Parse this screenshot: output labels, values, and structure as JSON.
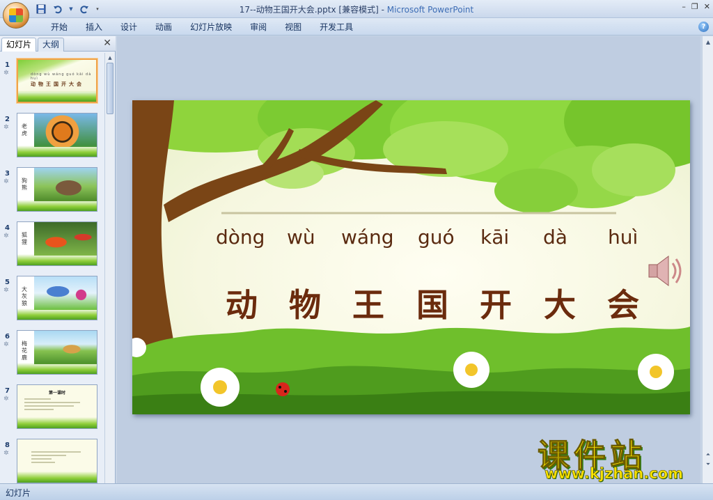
{
  "window": {
    "title": "17--动物王国开大会.pptx [兼容模式]",
    "separator": " - ",
    "app_name": "Microsoft PowerPoint",
    "minimize": "–",
    "restore": "❐",
    "close": "✕"
  },
  "quick_access": {
    "save_icon": "save-icon",
    "undo_icon": "undo-icon",
    "redo_icon": "redo-icon",
    "customize_icon": "dropdown-icon"
  },
  "ribbon": {
    "tabs": [
      "开始",
      "插入",
      "设计",
      "动画",
      "幻灯片放映",
      "审阅",
      "视图",
      "开发工具"
    ],
    "help": "?"
  },
  "left_pane": {
    "tab_slides": "幻灯片",
    "tab_outline": "大纲",
    "close": "✕",
    "slides": [
      {
        "num": "1",
        "label": "",
        "pinyin": "dòng wù wáng guó kāi dà huì",
        "title": "动物王国开大会"
      },
      {
        "num": "2",
        "label": "老虎"
      },
      {
        "num": "3",
        "label": "狗熊"
      },
      {
        "num": "4",
        "label": "狐狸"
      },
      {
        "num": "5",
        "label": "大灰狼"
      },
      {
        "num": "6",
        "label": "梅花鹿"
      },
      {
        "num": "7",
        "label": "",
        "heading": "第一课时"
      },
      {
        "num": "8",
        "label": ""
      }
    ]
  },
  "slide": {
    "pinyin": [
      "dòng",
      "wù",
      "wáng",
      "guó",
      "kāi",
      "dà",
      "huì"
    ],
    "hanzi": [
      "动",
      "物",
      "王",
      "国",
      "开",
      "大",
      "会"
    ],
    "audio_icon": "speaker-icon"
  },
  "watermark": {
    "cn": "课件站",
    "url": "www.kjzhan.com"
  },
  "statusbar": {
    "text": "幻灯片"
  }
}
